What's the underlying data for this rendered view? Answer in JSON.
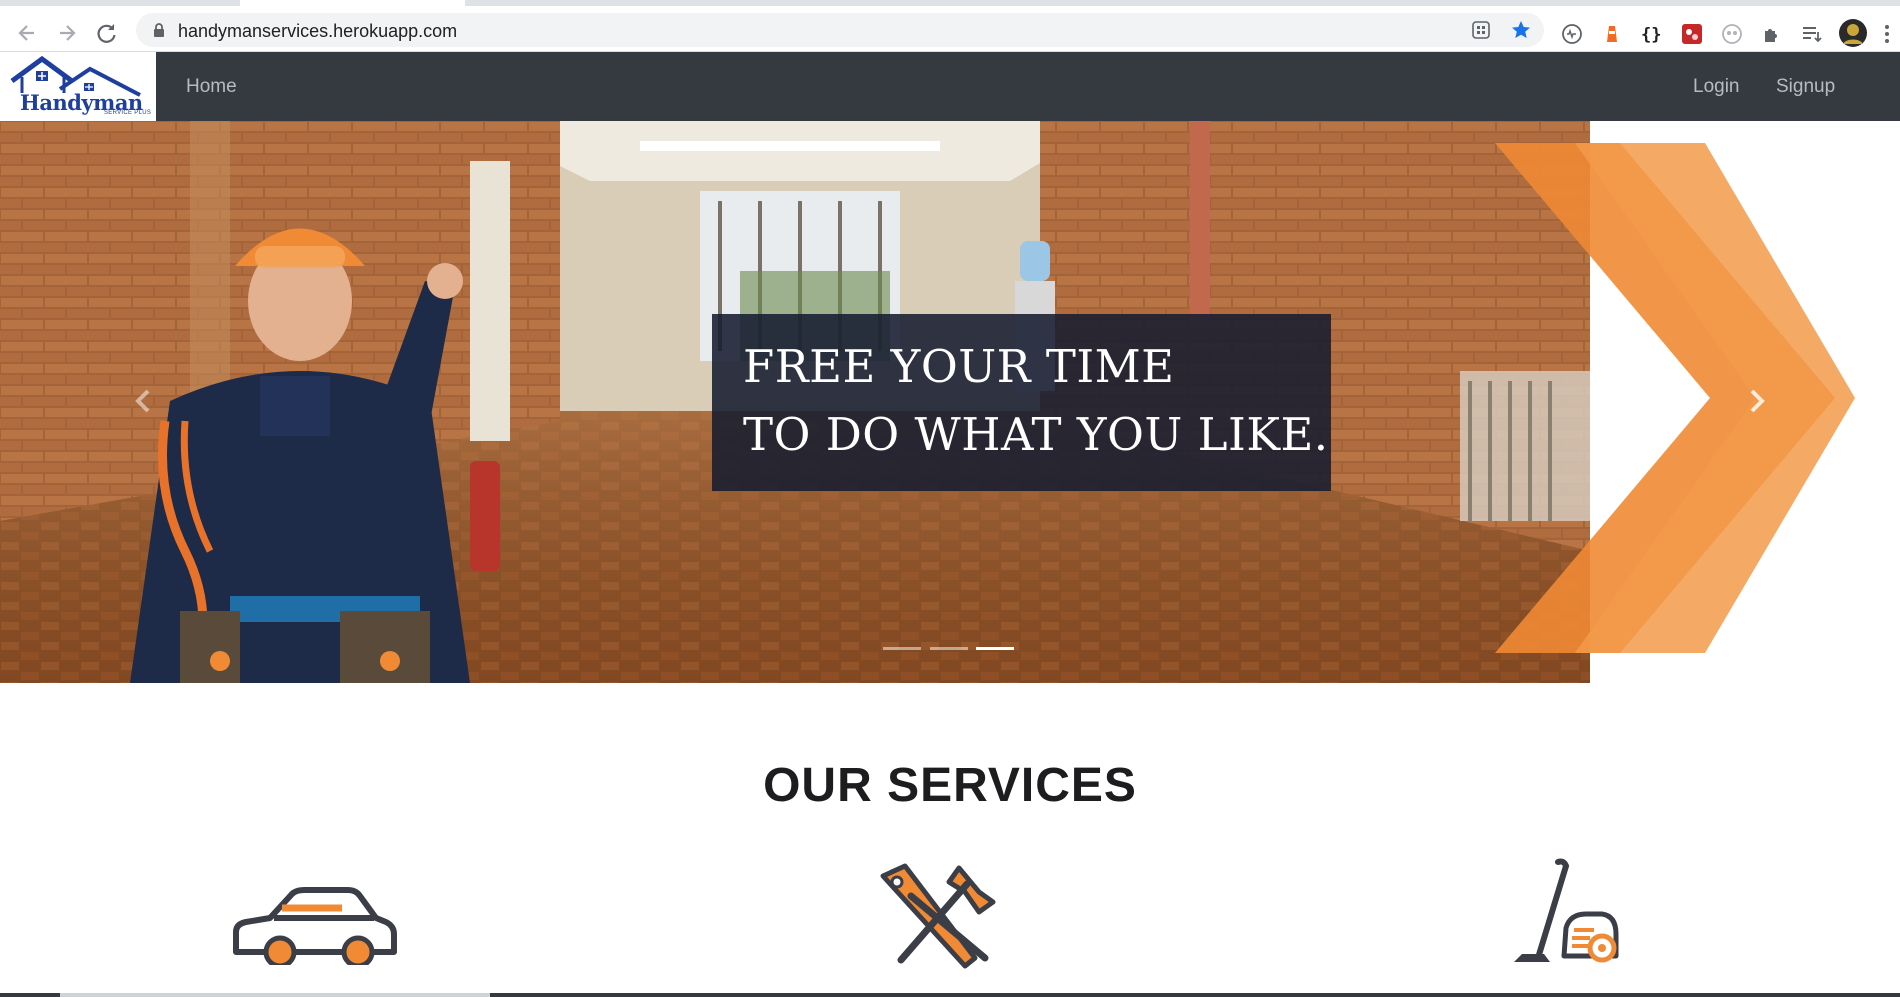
{
  "browser": {
    "url": "handymanservices.herokuapp.com",
    "icons": [
      "back-icon",
      "forward-icon",
      "reload-icon",
      "lock-icon",
      "app-grid-icon",
      "bookmark-star-icon",
      "extension-icons",
      "puzzle-icon",
      "reading-list-icon",
      "profile-avatar",
      "kebab-menu-icon"
    ]
  },
  "navbar": {
    "logo_text": "Handyman",
    "logo_subtext": "SERVICE PLUS",
    "home_label": "Home",
    "login_label": "Login",
    "signup_label": "Signup"
  },
  "hero": {
    "caption_line1": "FREE YOUR TIME",
    "caption_line2": "TO DO WHAT YOU LIKE.",
    "slide_count": 3,
    "active_slide": 3
  },
  "services": {
    "title": "OUR SERVICES",
    "items": [
      {
        "icon": "car-icon"
      },
      {
        "icon": "tools-icon"
      },
      {
        "icon": "vacuum-cleaner-icon"
      }
    ]
  },
  "colors": {
    "navbar": "#343a40",
    "accent_orange": "#f08a35",
    "logo_blue": "#1f3f9e"
  }
}
